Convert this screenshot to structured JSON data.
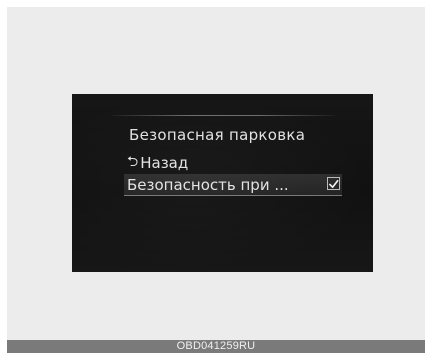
{
  "screen": {
    "menu_title": "Безопасная парковка",
    "back_item": {
      "icon": "back-arrow-icon",
      "glyph": "⮌",
      "label": "Назад"
    },
    "selected_item": {
      "label": "Безопасность при ...",
      "checked": true
    }
  },
  "footer": {
    "code": "OBD041259RU"
  },
  "colors": {
    "screen_bg": "#141414",
    "text": "#e2e2e2",
    "page_bg": "#ececec",
    "footer_bg": "#7a7a7a"
  }
}
